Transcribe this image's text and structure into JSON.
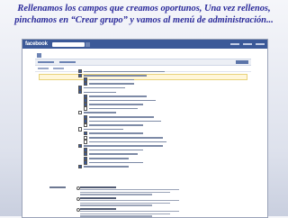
{
  "caption": {
    "line1": "Rellenamos los campos que creamos oportunos,  Una vez rellenos,",
    "line2": "pinchamos en “Crear grupo” y vamos al menú de administración..."
  },
  "screenshot": {
    "logo": "facebook",
    "option_states": [
      true,
      true,
      true,
      true,
      true,
      true,
      true,
      true,
      true,
      false,
      false,
      true,
      true,
      false,
      false,
      true,
      false,
      false,
      true,
      true,
      true,
      true,
      true,
      true
    ],
    "privacy_options": 3
  }
}
